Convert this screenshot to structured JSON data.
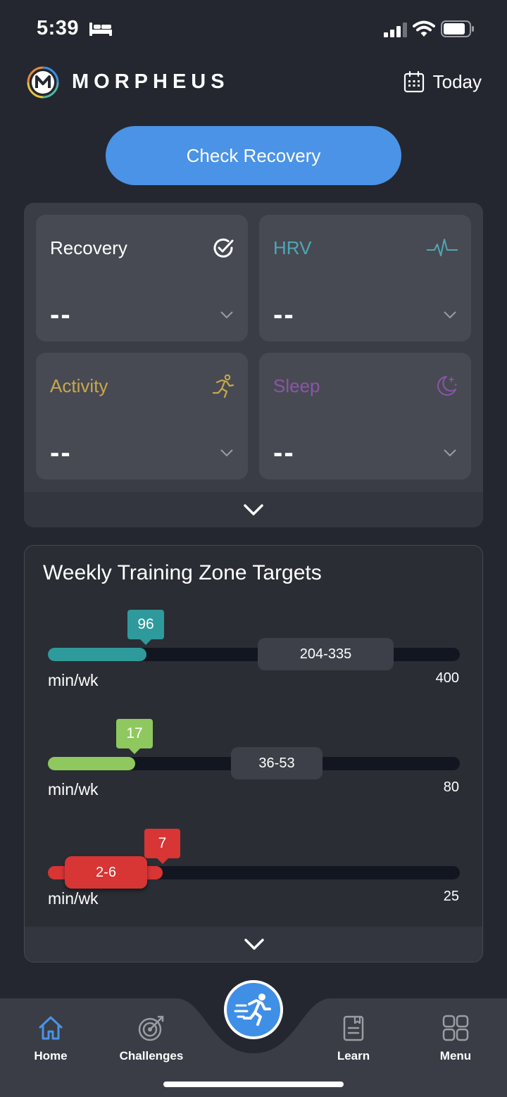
{
  "status_bar": {
    "time": "5:39"
  },
  "header": {
    "brand": "MORPHEUS",
    "date_label": "Today"
  },
  "check_button": "Check Recovery",
  "metrics": {
    "recovery": {
      "title": "Recovery",
      "value": "--",
      "color": "#ffffff"
    },
    "hrv": {
      "title": "HRV",
      "value": "--",
      "color": "#4fa7b4"
    },
    "activity": {
      "title": "Activity",
      "value": "--",
      "color": "#c9a84a"
    },
    "sleep": {
      "title": "Sleep",
      "value": "--",
      "color": "#8b55a8"
    }
  },
  "zones": {
    "title": "Weekly Training Zone Targets",
    "rows": [
      {
        "value": "96",
        "range": "204-335",
        "unit": "min/wk",
        "max": "400",
        "color": "#2f9a9c",
        "fill_fraction": 0.24
      },
      {
        "value": "17",
        "range": "36-53",
        "unit": "min/wk",
        "max": "80",
        "color": "#8fc85e",
        "fill_fraction": 0.21
      },
      {
        "value": "7",
        "range": "2-6",
        "unit": "min/wk",
        "max": "25",
        "color": "#d83535",
        "fill_fraction": 0.28
      }
    ]
  },
  "tabbar": {
    "home": "Home",
    "challenges": "Challenges",
    "learn": "Learn",
    "menu": "Menu"
  },
  "colors": {
    "accent": "#4a93e6",
    "background": "#24272f",
    "card": "#474a53"
  }
}
